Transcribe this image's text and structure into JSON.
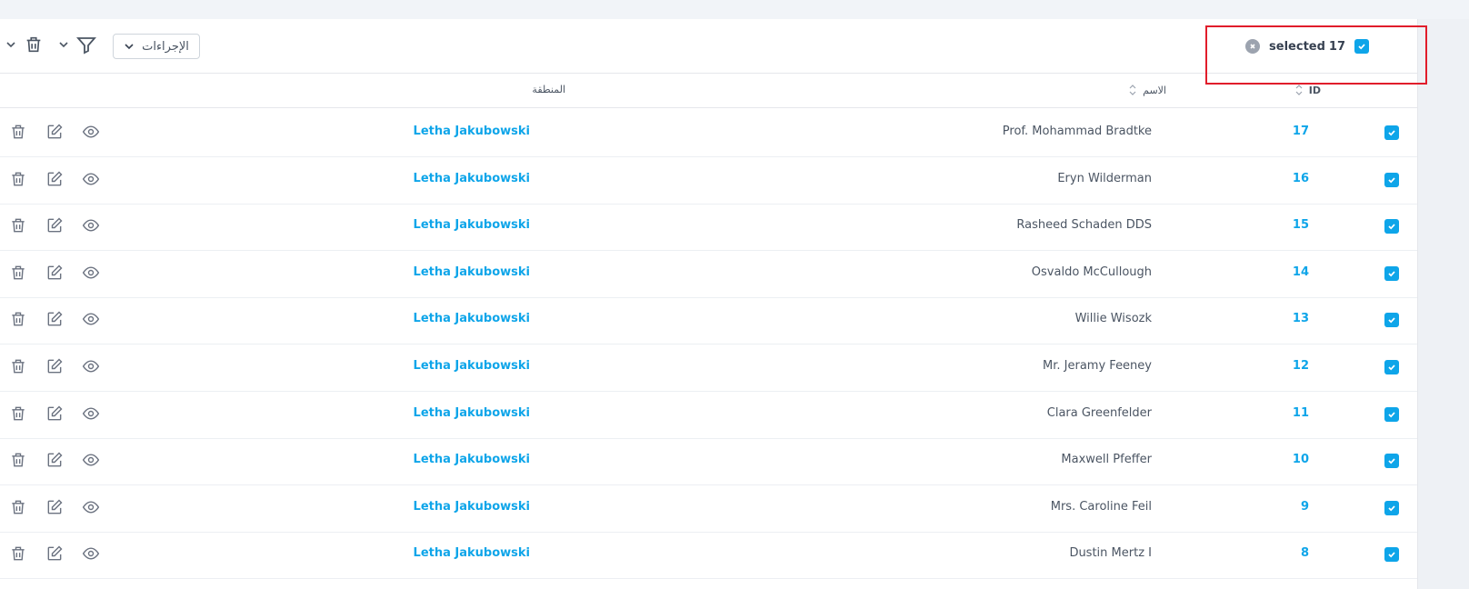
{
  "toolbar": {
    "actions_label": "الإجراءات",
    "selected_count": "17",
    "selected_label": "selected"
  },
  "table": {
    "columns": {
      "id": "ID",
      "name": "الاسم",
      "region": "المنطقة"
    },
    "rows": [
      {
        "id": "17",
        "name": "Prof. Mohammad Bradtke",
        "region": "Letha Jakubowski"
      },
      {
        "id": "16",
        "name": "Eryn Wilderman",
        "region": "Letha Jakubowski"
      },
      {
        "id": "15",
        "name": "Rasheed Schaden DDS",
        "region": "Letha Jakubowski"
      },
      {
        "id": "14",
        "name": "Osvaldo McCullough",
        "region": "Letha Jakubowski"
      },
      {
        "id": "13",
        "name": "Willie Wisozk",
        "region": "Letha Jakubowski"
      },
      {
        "id": "12",
        "name": "Mr. Jeramy Feeney",
        "region": "Letha Jakubowski"
      },
      {
        "id": "11",
        "name": "Clara Greenfelder",
        "region": "Letha Jakubowski"
      },
      {
        "id": "10",
        "name": "Maxwell Pfeffer",
        "region": "Letha Jakubowski"
      },
      {
        "id": "9",
        "name": "Mrs. Caroline Feil",
        "region": "Letha Jakubowski"
      },
      {
        "id": "8",
        "name": "Dustin Mertz I",
        "region": "Letha Jakubowski"
      }
    ]
  },
  "colors": {
    "accent": "#0ea5e9",
    "highlight": "#e11d2b"
  }
}
